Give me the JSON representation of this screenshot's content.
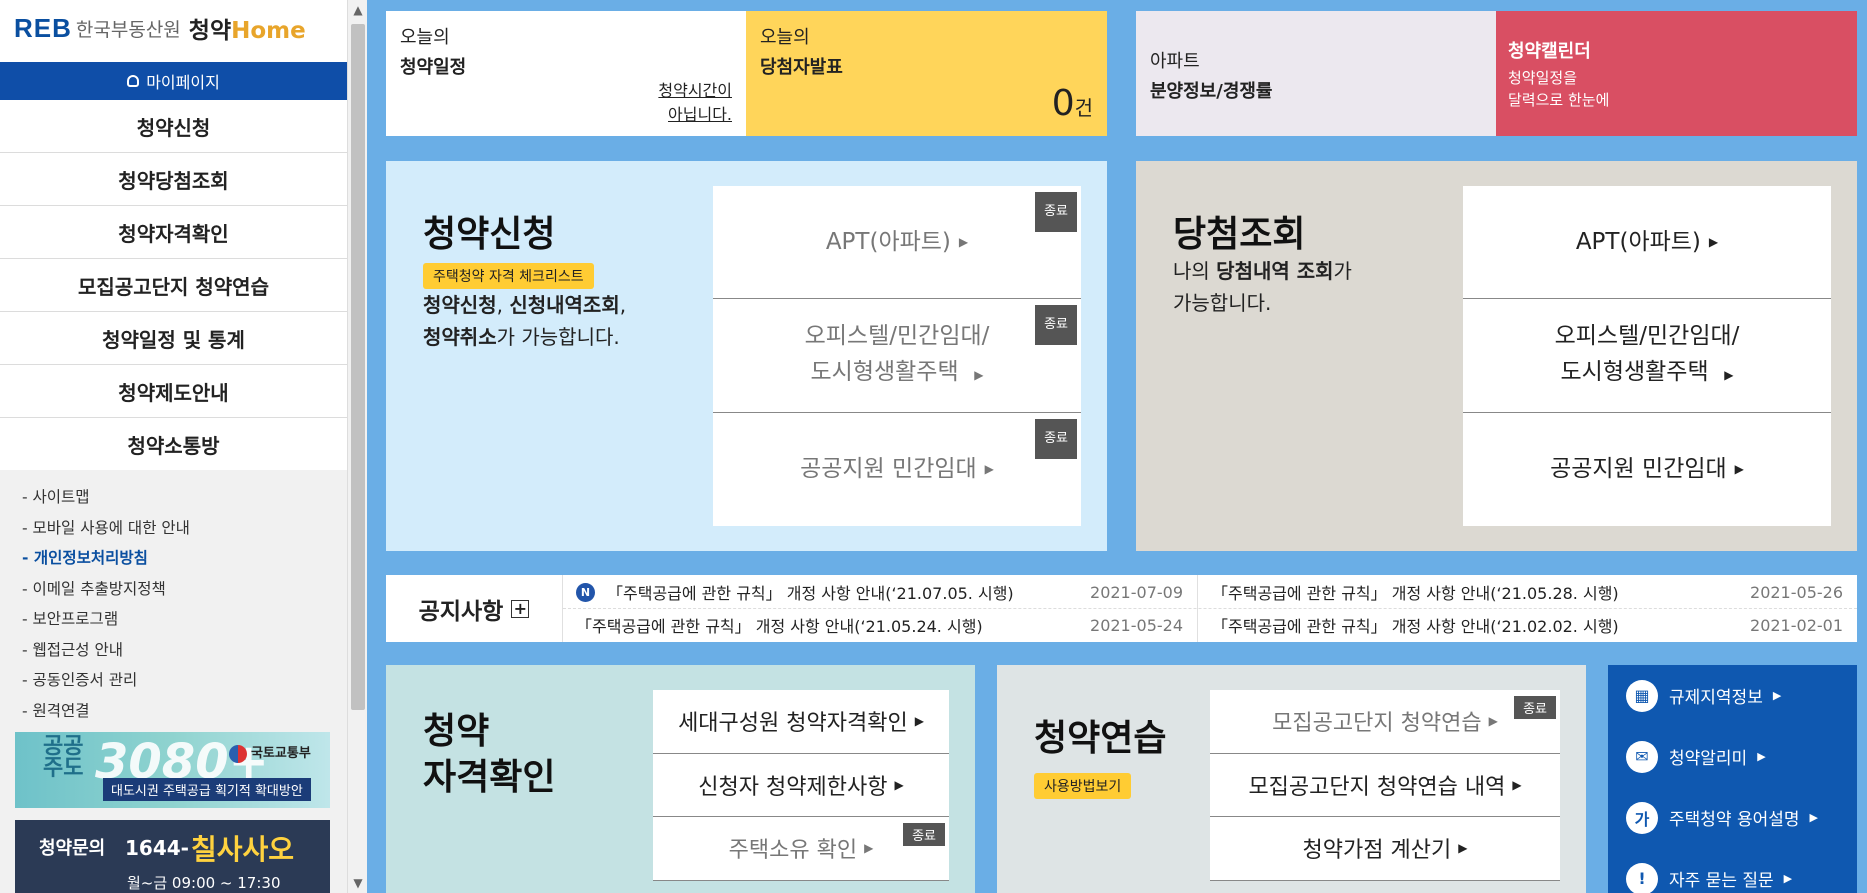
{
  "header": {
    "logo_reb": "REB",
    "logo_org": "한국부동산원",
    "logo_home_a": "청약",
    "logo_home_b": "Home"
  },
  "sidebar": {
    "mypage": "마이페이지",
    "menu": [
      {
        "label": "청약신청"
      },
      {
        "label": "청약당첨조회"
      },
      {
        "label": "청약자격확인"
      },
      {
        "label": "모집공고단지 청약연습"
      },
      {
        "label": "청약일정 및 통계"
      },
      {
        "label": "청약제도안내"
      },
      {
        "label": "청약소통방"
      }
    ],
    "sublinks": [
      {
        "label": "- 사이트맵"
      },
      {
        "label": "- 모바일 사용에 대한 안내"
      },
      {
        "label": "- 개인정보처리방침",
        "active": true
      },
      {
        "label": "- 이메일 추출방지정책"
      },
      {
        "label": "- 보안프로그램"
      },
      {
        "label": "- 웹접근성 안내"
      },
      {
        "label": "- 공동인증서 관리"
      },
      {
        "label": "- 원격연결"
      }
    ],
    "banner": {
      "line1": "공공\n주도",
      "big": "3080+",
      "ministry": "국토교통부",
      "caption": "대도시권 주택공급 획기적 확대방안"
    },
    "inquiry": {
      "label": "청약문의",
      "prefix": "1644-",
      "number": "칠사사오",
      "hours": "월~금 09:00 ~ 17:30"
    }
  },
  "top": {
    "schedule": {
      "line1": "오늘의",
      "line2": "청약일정",
      "status": "청약시간이 아닙니다."
    },
    "winners": {
      "line1": "오늘의",
      "line2": "당첨자발표",
      "count": "0",
      "unit": "건"
    },
    "apt": {
      "line1": "아파트",
      "line2": "분양정보/경쟁률"
    },
    "calendar": {
      "title": "청약캘린더",
      "desc1": "청약일정을",
      "desc2": "달력으로 한눈에"
    }
  },
  "apply": {
    "title": "청약신청",
    "badge": "주택청약 자격 체크리스트",
    "desc_b1": "청약신청",
    "desc_t1": ", ",
    "desc_b2": "신청내역조회",
    "desc_t2": ",",
    "desc_b3": "청약취소",
    "desc_t3": "가 가능합니다.",
    "options": [
      {
        "label": "APT(아파트)",
        "tag": "종료"
      },
      {
        "label": "오피스텔/민간임대/",
        "label2": "도시형생활주택",
        "tag": "종료"
      },
      {
        "label": "공공지원 민간임대",
        "tag": "종료"
      }
    ]
  },
  "winner": {
    "title": "당첨조회",
    "desc_t1": "나의 ",
    "desc_b1": "당첨내역 조회",
    "desc_t2": "가",
    "desc_t3": "가능합니다.",
    "options": [
      {
        "label": "APT(아파트)"
      },
      {
        "label": "오피스텔/민간임대/",
        "label2": "도시형생활주택"
      },
      {
        "label": "공공지원 민간임대"
      }
    ]
  },
  "notice": {
    "label": "공지사항",
    "new_badge": "N",
    "items": [
      {
        "title": "「주택공급에 관한 규칙」 개정 사항 안내(‘21.07.05. 시행)",
        "date": "2021-07-09"
      },
      {
        "title": "「주택공급에 관한 규칙」 개정 사항 안내(‘21.05.28. 시행)",
        "date": "2021-05-26"
      },
      {
        "title": "「주택공급에 관한 규칙」 개정 사항 안내(‘21.05.24. 시행)",
        "date": "2021-05-24"
      },
      {
        "title": "「주택공급에 관한 규칙」 개정 사항 안내(‘21.02.02. 시행)",
        "date": "2021-02-01"
      }
    ]
  },
  "qualification": {
    "title1": "청약",
    "title2": "자격확인",
    "items": [
      {
        "label": "세대구성원 청약자격확인"
      },
      {
        "label": "신청자 청약제한사항"
      },
      {
        "label": "주택소유 확인",
        "tag": "종료"
      }
    ]
  },
  "practice": {
    "title": "청약연습",
    "badge": "사용방법보기",
    "items": [
      {
        "label": "모집공고단지 청약연습",
        "tag": "종료"
      },
      {
        "label": "모집공고단지 청약연습 내역"
      },
      {
        "label": "청약가점 계산기"
      }
    ]
  },
  "quick": [
    {
      "label": "규제지역정보",
      "icon": "building-icon"
    },
    {
      "label": "청약알리미",
      "icon": "mail-icon"
    },
    {
      "label": "주택청약 용어설명",
      "icon": "ga-glyph-icon",
      "glyph": "가"
    },
    {
      "label": "자주 묻는 질문",
      "icon": "exclamation-icon",
      "glyph": "!"
    }
  ],
  "colors": {
    "background": "#6aaee6",
    "brand_blue": "#0f4ea8",
    "winners_yellow": "#ffd55a",
    "calendar_red": "#d94f63",
    "apply_panel": "#d3ecfb",
    "winner_panel": "#dcd9d2",
    "closed_tag": "#555555"
  }
}
